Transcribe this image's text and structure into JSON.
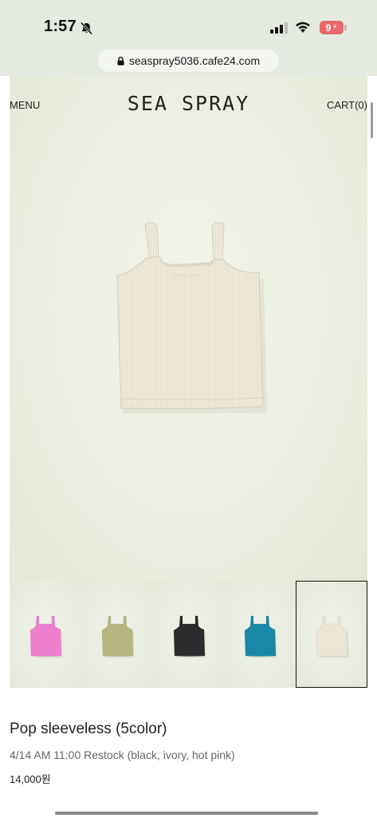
{
  "status_bar": {
    "time": "1:57",
    "battery": "9",
    "icons": [
      "bell-slash-icon",
      "signal-icon",
      "wifi-icon",
      "battery-icon"
    ]
  },
  "browser": {
    "url": "seaspray5036.cafe24.com",
    "icon": "lock-icon"
  },
  "header": {
    "menu_label": "MENU",
    "logo": "SEA SPRAY",
    "cart_label": "CART(0)"
  },
  "gallery": {
    "main_color": "#efe9da",
    "thumbnails": [
      {
        "color": "#ee7fcf"
      },
      {
        "color": "#b7b67f"
      },
      {
        "color": "#2b2b2d"
      },
      {
        "color": "#1988a6"
      },
      {
        "color": "#ebe5d6",
        "selected": true
      }
    ]
  },
  "product": {
    "name": "Pop sleeveless (5color)",
    "description": "4/14 AM 11:00 Restock (black, ivory, hot pink)",
    "price": "14,000원"
  }
}
